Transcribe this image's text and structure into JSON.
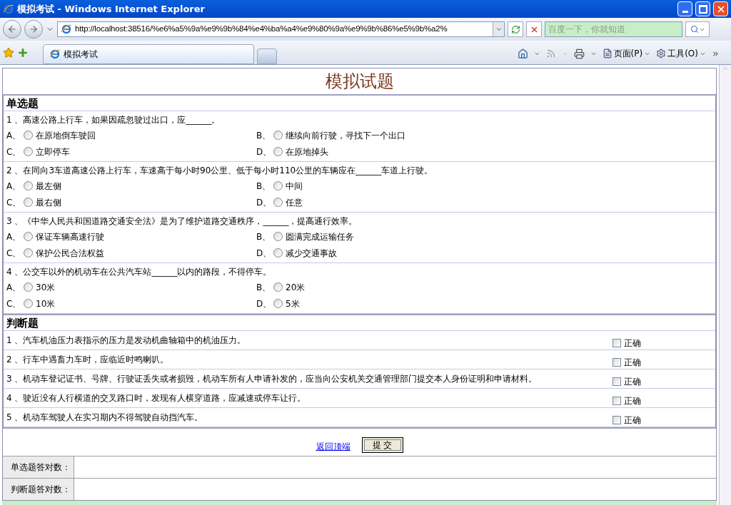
{
  "window": {
    "title": "模拟考试 - Windows Internet Explorer"
  },
  "address": {
    "value": "http://localhost:38516/%e6%a5%9a%e9%9b%84%e4%ba%a4%e9%80%9a%e9%9b%86%e5%9b%a2%"
  },
  "search": {
    "placeholder": "百度一下，你就知道"
  },
  "tabs": [
    {
      "label": "模拟考试",
      "selected": true
    }
  ],
  "commands": [
    "页面(P)",
    "工具(O)"
  ],
  "page": {
    "title": "模拟试题",
    "single": {
      "heading": "单选题",
      "questions": [
        {
          "text": "1 、高速公路上行车，如果因疏忽驶过出口，应______。",
          "options": [
            {
              "letter": "A、",
              "text": "在原地倒车驶回",
              "selected": false
            },
            {
              "letter": "B、",
              "text": "继续向前行驶，寻找下一个出口",
              "selected": false
            },
            {
              "letter": "C、",
              "text": "立即停车",
              "selected": false
            },
            {
              "letter": "D、",
              "text": "在原地掉头",
              "selected": false
            }
          ]
        },
        {
          "text": "2 、在同向3车道高速公路上行车，车速高于每小时90公里、低于每小时110公里的车辆应在______车道上行驶。",
          "options": [
            {
              "letter": "A、",
              "text": "最左侧",
              "selected": false
            },
            {
              "letter": "B、",
              "text": "中间",
              "selected": false
            },
            {
              "letter": "C、",
              "text": "最右侧",
              "selected": false
            },
            {
              "letter": "D、",
              "text": "任意",
              "selected": false
            }
          ]
        },
        {
          "text": "3 、《中华人民共和国道路交通安全法》是为了维护道路交通秩序，______，提高通行效率。",
          "options": [
            {
              "letter": "A、",
              "text": "保证车辆高速行驶",
              "selected": false
            },
            {
              "letter": "B、",
              "text": "圆满完成运输任务",
              "selected": false
            },
            {
              "letter": "C、",
              "text": "保护公民合法权益",
              "selected": false
            },
            {
              "letter": "D、",
              "text": "减少交通事故",
              "selected": false
            }
          ]
        },
        {
          "text": "4 、公交车以外的机动车在公共汽车站______以内的路段，不得停车。",
          "options": [
            {
              "letter": "A、",
              "text": "30米",
              "selected": false
            },
            {
              "letter": "B、",
              "text": "20米",
              "selected": false
            },
            {
              "letter": "C、",
              "text": "10米",
              "selected": false
            },
            {
              "letter": "D、",
              "text": "5米",
              "selected": false
            }
          ]
        }
      ]
    },
    "judge": {
      "heading": "判断题",
      "questions": [
        {
          "text": "1 、汽车机油压力表指示的压力是发动机曲轴箱中的机油压力。",
          "label": "正确",
          "checked": false
        },
        {
          "text": "2 、行车中遇畜力车时，应临近时鸣喇叭。",
          "label": "正确",
          "checked": false
        },
        {
          "text": "3 、机动车登记证书、号牌、行驶证丢失或者损毁，机动车所有人申请补发的，应当向公安机关交通管理部门提交本人身份证明和申请材料。",
          "label": "正确",
          "checked": false
        },
        {
          "text": "4 、驶近没有人行横道的交叉路口时，发现有人横穿道路，应减速或停车让行。",
          "label": "正确",
          "checked": false
        },
        {
          "text": "5 、机动车驾驶人在实习期内不得驾驶自动挡汽车。",
          "label": "正确",
          "checked": false
        }
      ]
    },
    "back_link": "返回顶端",
    "submit": "提 交",
    "scores": [
      {
        "label": "单选题答对数："
      },
      {
        "label": "判断题答对数："
      }
    ]
  }
}
